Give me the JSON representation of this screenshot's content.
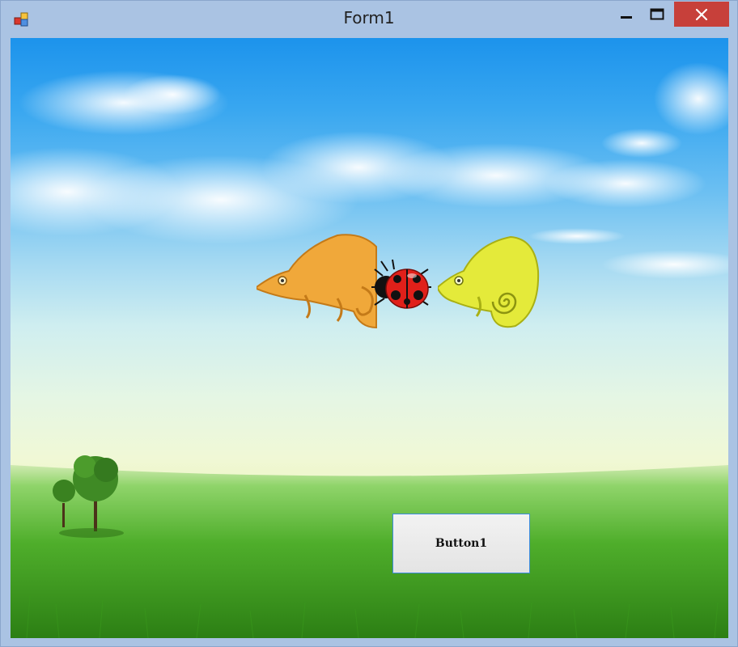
{
  "window": {
    "title": "Form1",
    "icon": "app-window-icon",
    "controls": {
      "minimize_icon": "minimize-icon",
      "maximize_icon": "maximize-icon",
      "close_icon": "close-icon"
    },
    "close_color": "#c7403a",
    "frame_color": "#aac3e3"
  },
  "scene": {
    "background": "sky-and-meadow",
    "sprites": [
      "orange-chameleon",
      "ladybug",
      "yellow-chameleon",
      "tree"
    ]
  },
  "button1": {
    "label": "Button1"
  }
}
